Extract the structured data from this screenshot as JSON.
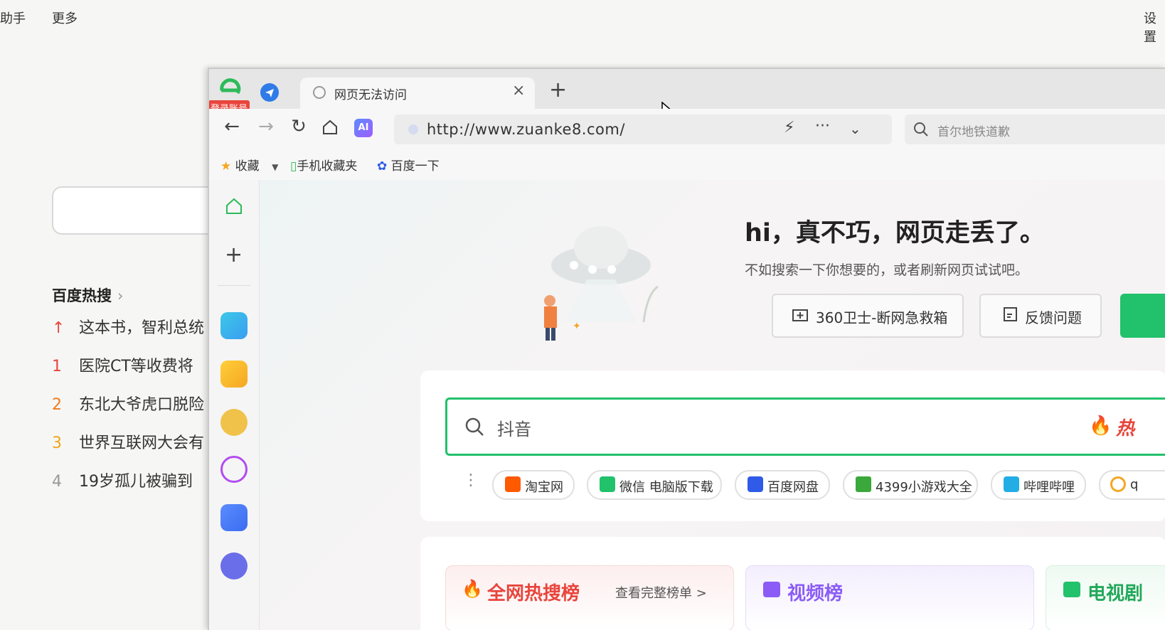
{
  "background_page": {
    "menu_assistant": "助手",
    "menu_more": "更多",
    "menu_settings": "设置",
    "hot_title": "百度热搜",
    "hot_items": [
      {
        "rank": "↑",
        "text": "这本书，智利总统"
      },
      {
        "rank": "1",
        "text": "医院CT等收费将"
      },
      {
        "rank": "2",
        "text": "东北大爷虎口脱险"
      },
      {
        "rank": "3",
        "text": "世界互联网大会有"
      },
      {
        "rank": "4",
        "text": "19岁孤儿被骗到"
      }
    ]
  },
  "browser": {
    "login_badge": "登录账号",
    "tab_title": "网页无法访问",
    "tab_close": "×",
    "new_tab": "+",
    "url": "http://www.zuanke8.com/",
    "search_placeholder": "首尔地铁道歉",
    "ai_label": "AI",
    "bookmarks": {
      "favorites": "收藏",
      "mobile_favorites": "手机收藏夹",
      "baidu": "百度一下"
    }
  },
  "error_page": {
    "headline": "hi，真不巧，网页走丢了。",
    "subline": "不如搜索一下你想要的，或者刷新网页试试吧。",
    "btn_rescue": "360卫士-断网急救箱",
    "btn_feedback": "反馈问题",
    "search_value": "抖音",
    "hot_label": "热",
    "chips": [
      "淘宝网",
      "微信 电脑版下载",
      "百度网盘",
      "4399小游戏大全",
      "哔哩哔哩",
      "q"
    ],
    "rank_tabs": {
      "all_hot": "全网热搜榜",
      "view_full": "查看完整榜单 >",
      "video": "视频榜",
      "tv": "电视剧"
    }
  },
  "colors": {
    "accent_green": "#22c16b",
    "hot_red": "#e8453c",
    "video_purple": "#8b5cf6"
  }
}
